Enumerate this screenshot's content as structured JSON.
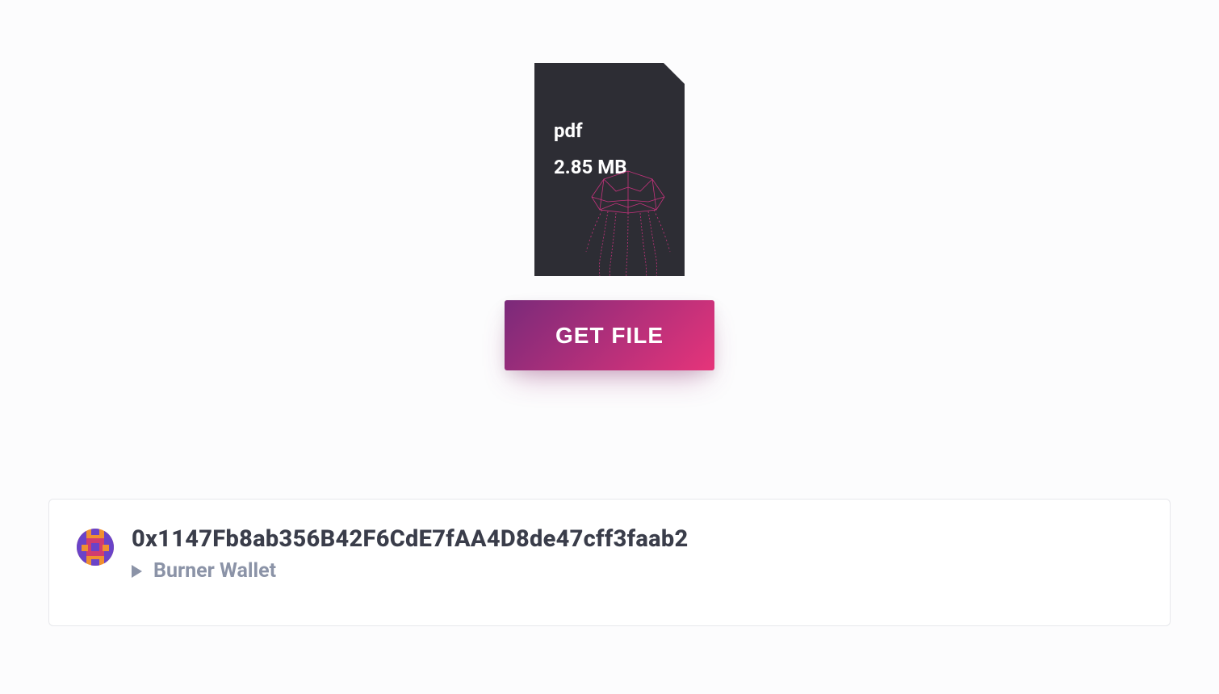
{
  "file": {
    "type": "pdf",
    "size": "2.85 MB",
    "icon_name": "jellyfish-icon"
  },
  "actions": {
    "get_file_label": "GET FILE"
  },
  "wallet": {
    "address": "0x1147Fb8ab356B42F6CdE7fAA4D8de47cff3faab2",
    "type_label": "Burner Wallet",
    "avatar_icon": "identicon"
  },
  "colors": {
    "button_gradient_start": "#7a2a7a",
    "button_gradient_end": "#e6347a",
    "file_card_bg": "#2d2d34",
    "text_primary": "#3a3d4a",
    "text_secondary": "#8b93a7"
  }
}
